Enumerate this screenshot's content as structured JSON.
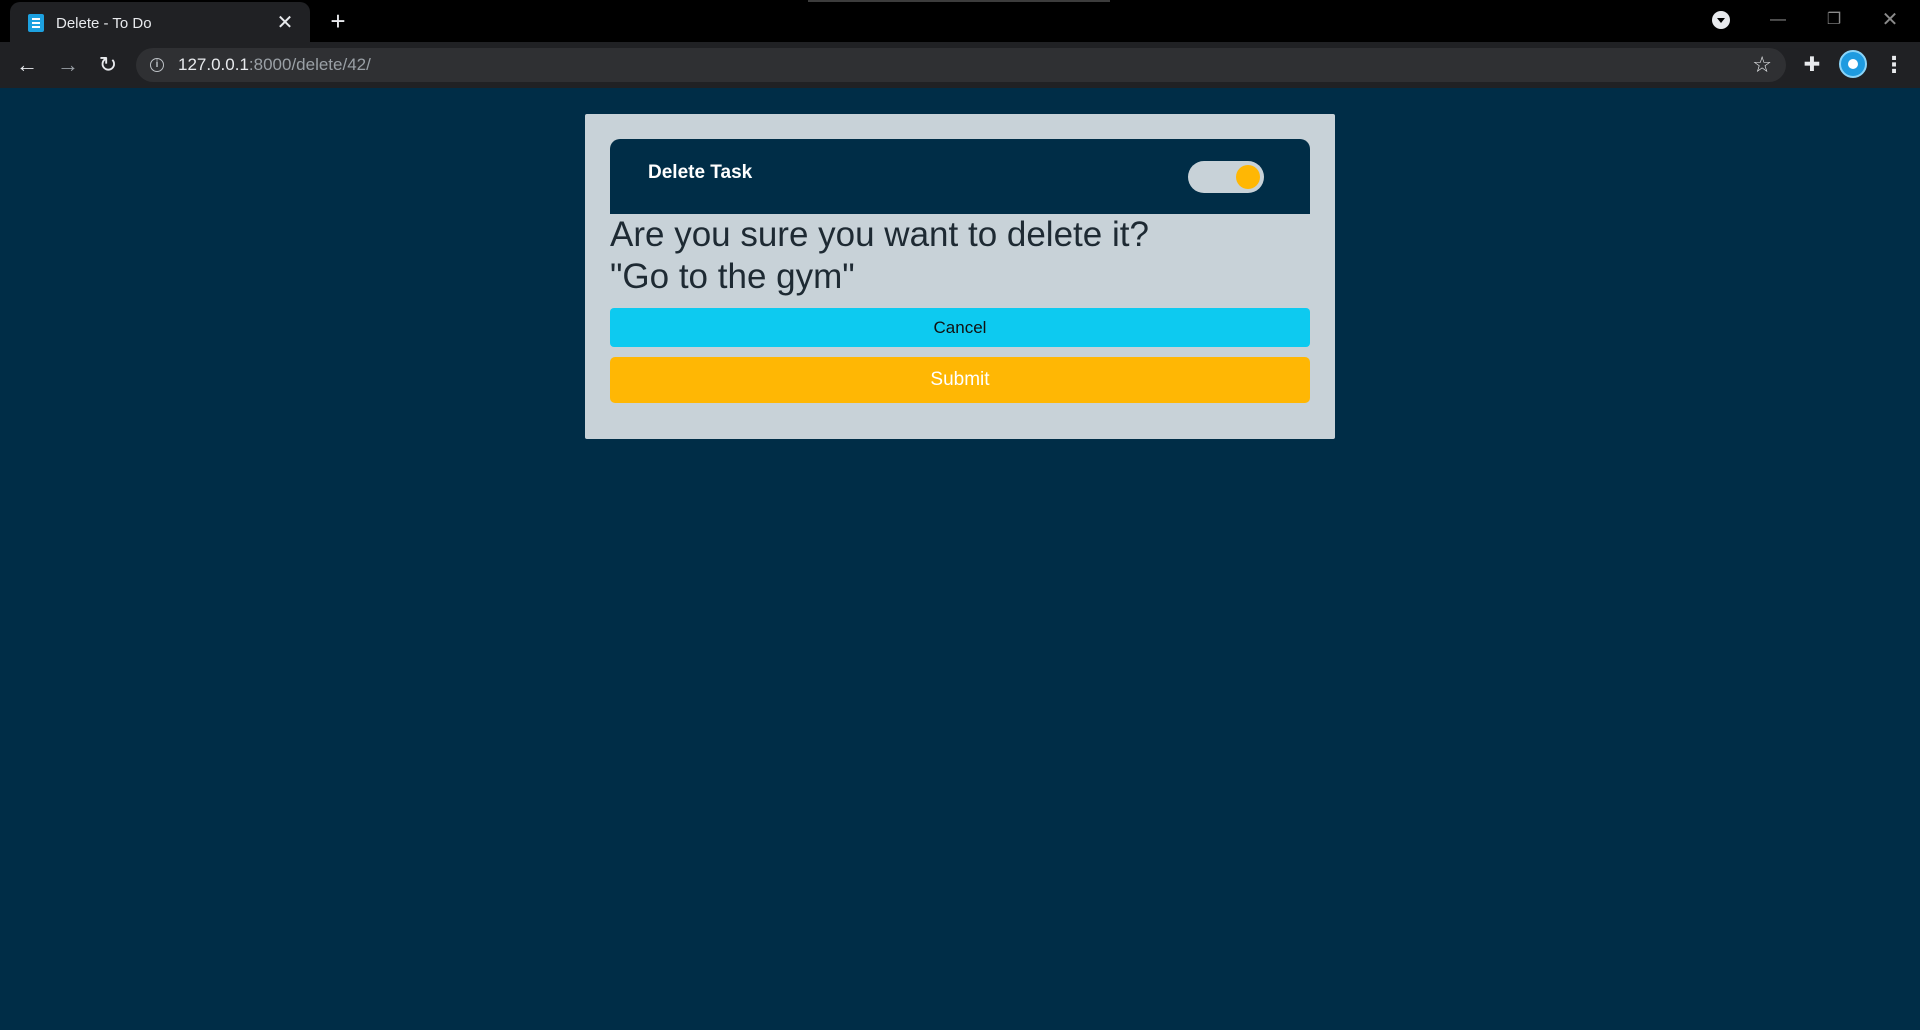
{
  "browser": {
    "tab_title": "Delete - To Do",
    "tab_close": "✕",
    "new_tab": "+",
    "url_host": "127.0.0.1",
    "url_path": ":8000/delete/42/",
    "icons": {
      "back": "back-arrow-icon",
      "forward": "forward-arrow-icon",
      "reload": "reload-icon",
      "info": "info-icon",
      "star": "bookmark-star-icon",
      "extensions": "puzzle-icon",
      "menu": "kebab-menu-icon"
    }
  },
  "page": {
    "header_title": "Delete Task",
    "question": "Are you sure you want to delete it?",
    "task_name": "\"Go to the gym\"",
    "cancel_label": "Cancel",
    "submit_label": "Submit",
    "toggle_on": true
  },
  "colors": {
    "background": "#002d47",
    "card": "#c8d2d8",
    "accent": "#ffb704",
    "cancel": "#0dcaf0"
  }
}
